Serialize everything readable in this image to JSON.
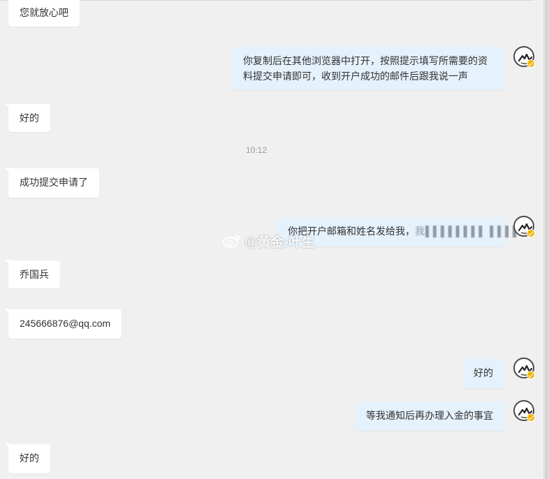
{
  "messages": {
    "m1": "您就放心吧",
    "m2": "你复制后在其他浏览器中打开，按照提示填写所需要的资料提交申请即可，收到开户成功的邮件后跟我说一声",
    "m3": "好的",
    "time1": "10:12",
    "m4": "成功提交申请了",
    "m5_text": "你把开户邮箱和姓名发给我，",
    "m5_blurred": "我▌▌▌▌▌▌▌▌ ▌▌▌▌",
    "m6": "乔国兵",
    "m7": "245666876@qq.com",
    "m8": "好的",
    "m9": "等我通知后再办理入金的事宜",
    "m10": "好的"
  },
  "watermark": {
    "text": "@黄金-叶生",
    "icon": "weibo-icon"
  },
  "avatar": {
    "icon": "agent-avatar-icon",
    "badge_icon": "verified-badge-icon",
    "badge_color": "#f5b100"
  },
  "colors": {
    "incoming_bubble": "#ffffff",
    "outgoing_bubble": "#e5f1fb",
    "background": "#f0f0f0"
  }
}
